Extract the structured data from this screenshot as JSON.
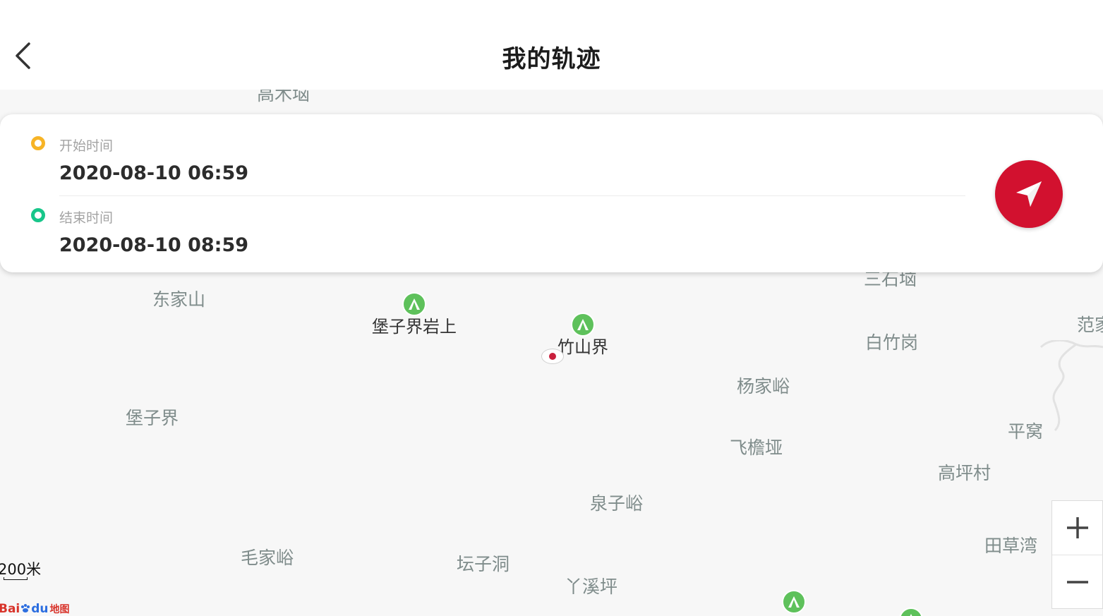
{
  "header": {
    "title": "我的轨迹"
  },
  "track": {
    "start_label": "开始时间",
    "start_value": "2020-08-10 06:59",
    "end_label": "结束时间",
    "end_value": "2020-08-10 08:59"
  },
  "map": {
    "places": {
      "gaomu": "高木垴",
      "sanshi": "三石垴",
      "dongjiashan": "东家山",
      "baozijieyan": "堡子界岩上",
      "zhushanjie": "竹山界",
      "fan": "范家",
      "baizhugang": "白竹岗",
      "yangjiayu": "杨家峪",
      "baozijie": "堡子界",
      "pingwo": "平窝",
      "feiyanya": "飞檐垭",
      "gaopingcun": "高坪村",
      "quanziyu": "泉子峪",
      "tiancaowan": "田草湾",
      "maojiayu": "毛家峪",
      "tanzidong": "坛子洞",
      "yaxiping": "丫溪坪"
    },
    "scale_label": "200米",
    "brand_bai": "Bai",
    "brand_du": "du",
    "brand_map": "地图"
  },
  "colors": {
    "accent": "#d2112f",
    "start_dot": "#f7b426",
    "end_dot": "#18c68a",
    "poi": "#5ec15b",
    "place_text": "#7f8c8b"
  },
  "icons": {
    "back": "chevron-left-icon",
    "navigate": "navigation-arrow-icon",
    "zoom_in": "plus-icon",
    "zoom_out": "minus-icon",
    "poi": "mountain-icon"
  }
}
